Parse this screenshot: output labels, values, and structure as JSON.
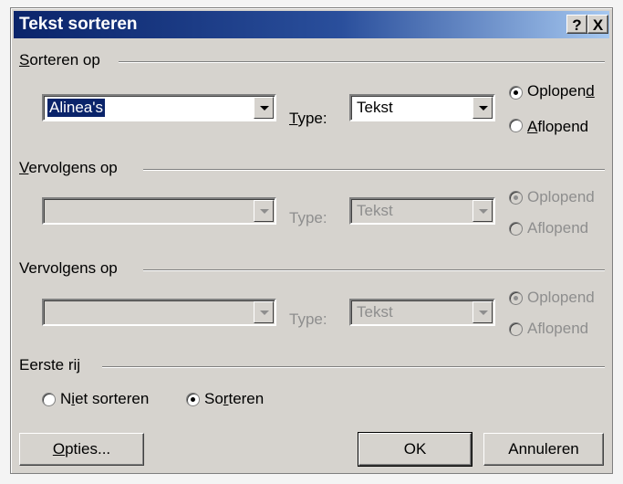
{
  "window": {
    "title": "Tekst sorteren",
    "help_label": "?",
    "close_label": "X"
  },
  "sort_by": {
    "label": "Sorteren op",
    "field_value": "Alinea's",
    "type_label": "Type:",
    "type_value": "Tekst",
    "ascending_label": "Oplopend",
    "descending_label": "Aflopend",
    "selected": "ascending"
  },
  "then_by_1": {
    "label": "Vervolgens op",
    "field_value": "",
    "type_label": "Type:",
    "type_value": "Tekst",
    "ascending_label": "Oplopend",
    "descending_label": "Aflopend",
    "enabled": false
  },
  "then_by_2": {
    "label": "Vervolgens op",
    "field_value": "",
    "type_label": "Type:",
    "type_value": "Tekst",
    "ascending_label": "Oplopend",
    "descending_label": "Aflopend",
    "enabled": false
  },
  "first_row": {
    "label": "Eerste rij",
    "no_sort_label": "Niet sorteren",
    "sort_label": "Sorteren",
    "selected": "sort"
  },
  "buttons": {
    "options_label": "Opties...",
    "ok_label": "OK",
    "cancel_label": "Annuleren"
  }
}
